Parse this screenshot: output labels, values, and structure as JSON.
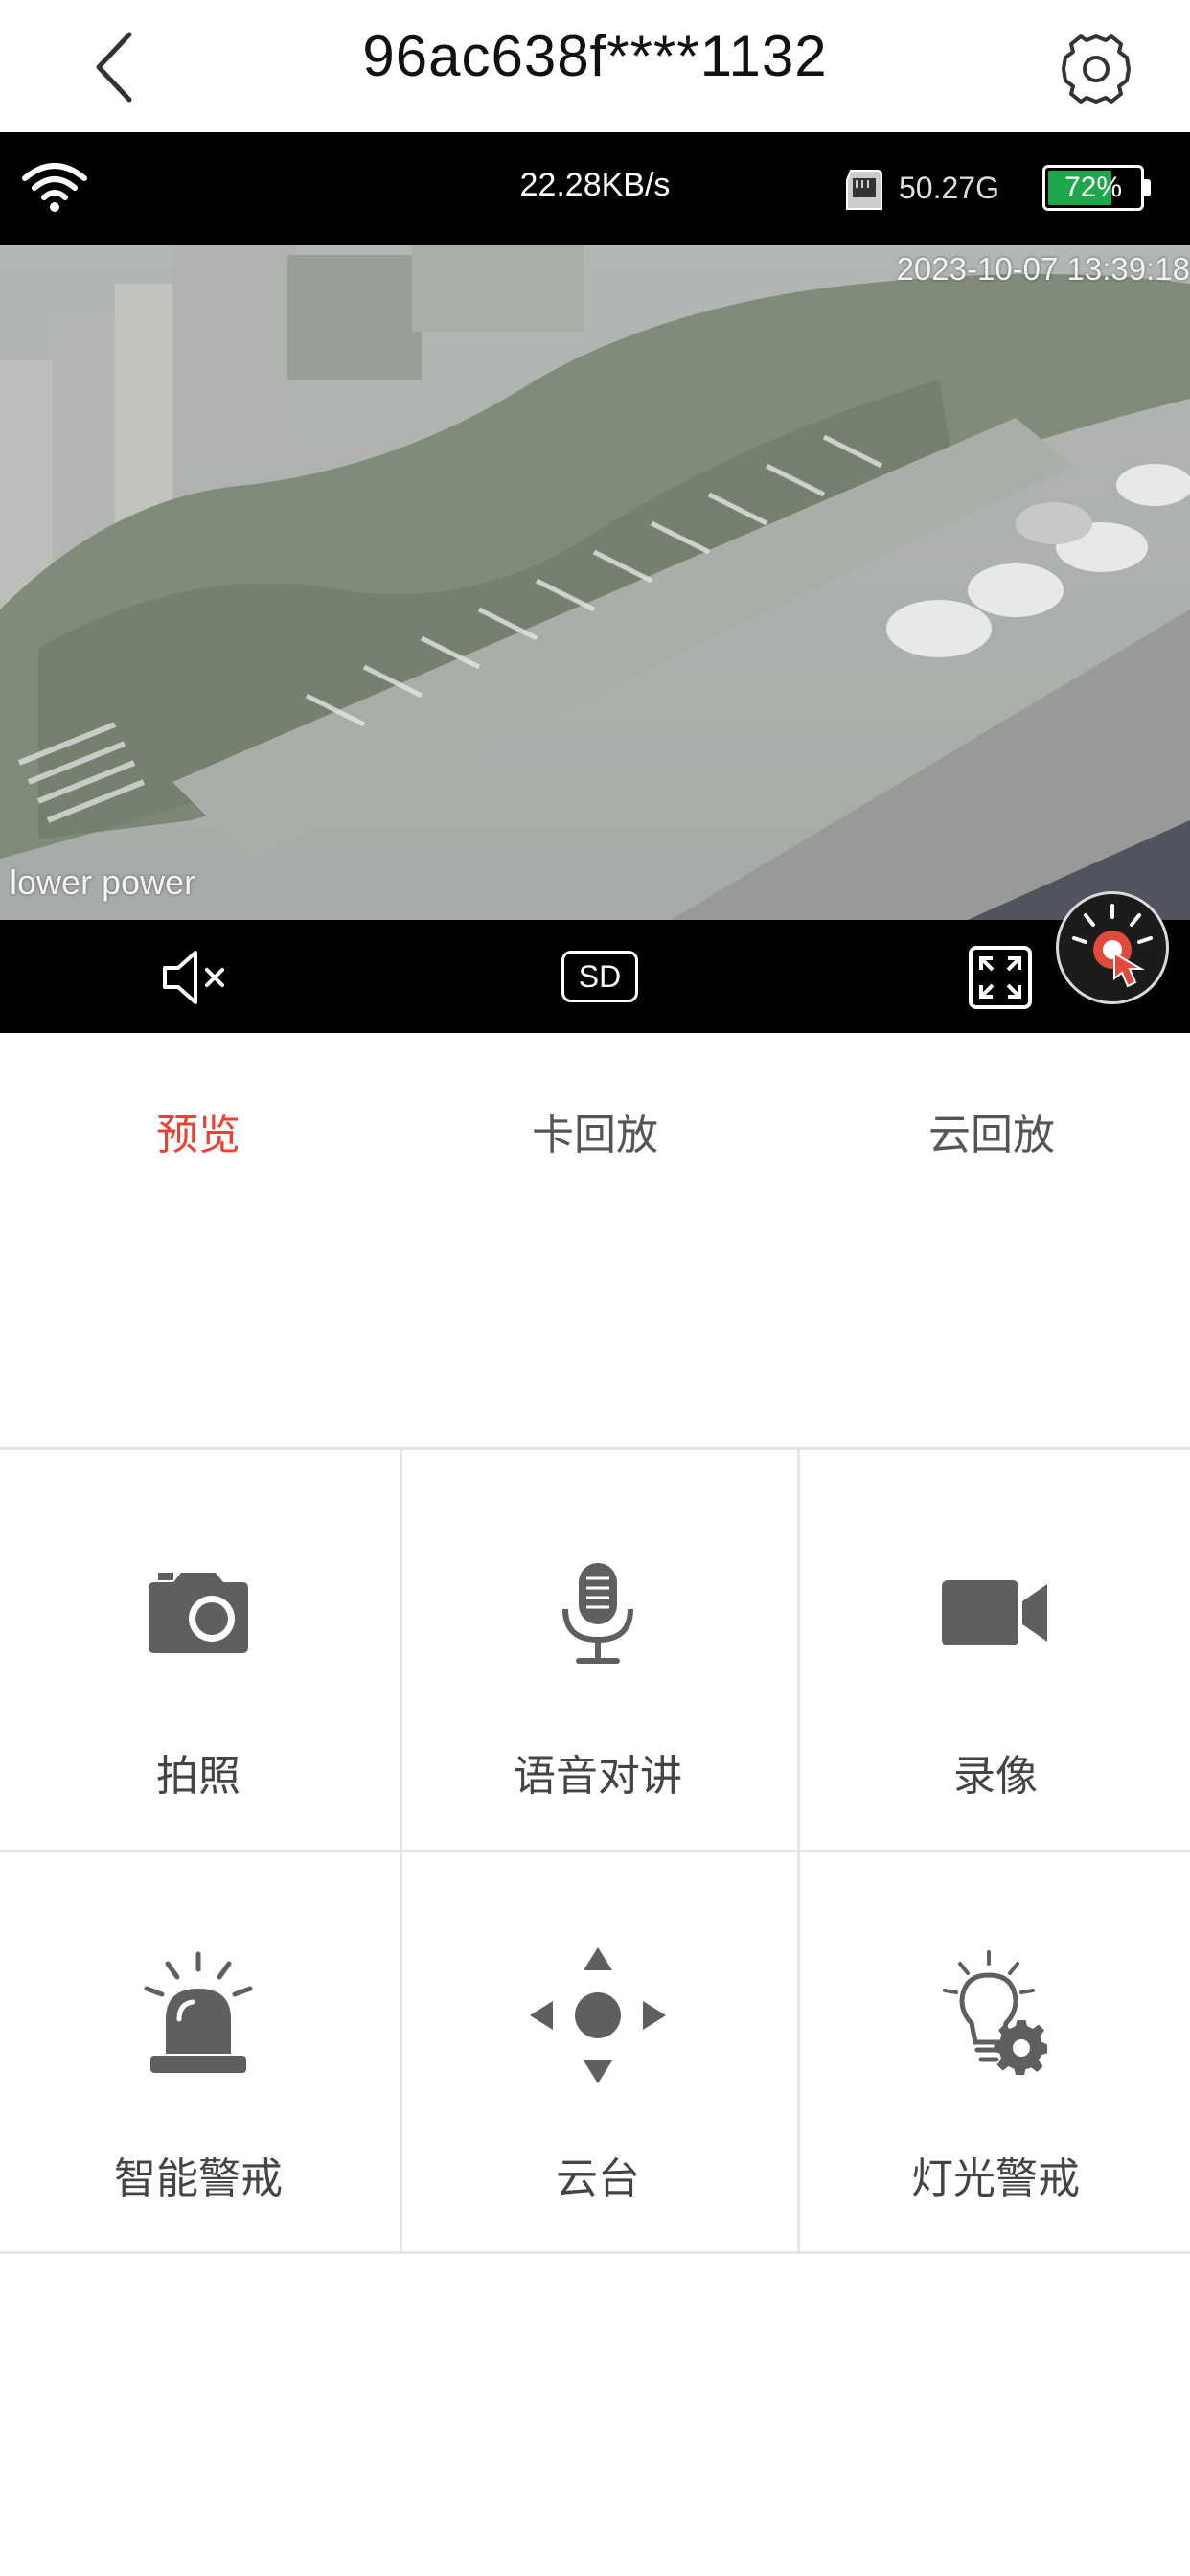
{
  "header": {
    "title": "96ac638f****1132",
    "back_icon": "chevron-left-icon",
    "settings_icon": "settings-gear-icon"
  },
  "status": {
    "speed": "22.28KB/s",
    "storage": "50.27G",
    "battery_text": "72%",
    "battery_level": 0.72,
    "battery_color": "#1fa84a"
  },
  "video": {
    "timestamp": "2023-10-07 13:39:18",
    "overlay_text": "lower power"
  },
  "controls": {
    "mute_icon": "speaker-mute-icon",
    "quality_label": "SD",
    "fullscreen_icon": "fullscreen-icon",
    "alarm_icon": "siren-touch-icon"
  },
  "tabs": [
    {
      "label": "预览",
      "active": true
    },
    {
      "label": "卡回放",
      "active": false
    },
    {
      "label": "云回放",
      "active": false
    }
  ],
  "functions": [
    {
      "label": "拍照",
      "icon": "camera-icon"
    },
    {
      "label": "语音对讲",
      "icon": "microphone-icon"
    },
    {
      "label": "录像",
      "icon": "video-camera-icon"
    },
    {
      "label": "智能警戒",
      "icon": "alarm-siren-icon"
    },
    {
      "label": "云台",
      "icon": "ptz-direction-icon"
    },
    {
      "label": "灯光警戒",
      "icon": "light-settings-icon"
    }
  ],
  "colors": {
    "accent": "#ea4335",
    "icon_gray": "#5f5f5f",
    "divider": "#e5e5e5"
  }
}
